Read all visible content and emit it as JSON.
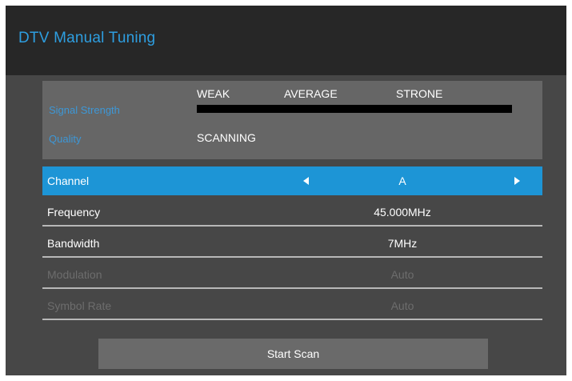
{
  "header": {
    "title": "DTV Manual Tuning"
  },
  "signal": {
    "strength_label": "Signal Strength",
    "quality_label": "Quality",
    "levels": [
      "WEAK",
      "AVERAGE",
      "STRONE"
    ],
    "strength_fraction": 0,
    "quality_value": "SCANNING"
  },
  "menu": {
    "rows": [
      {
        "label": "Channel",
        "value": "A",
        "selected": true,
        "disabled": false
      },
      {
        "label": "Frequency",
        "value": "45.000MHz",
        "selected": false,
        "disabled": false
      },
      {
        "label": "Bandwidth",
        "value": "7MHz",
        "selected": false,
        "disabled": false
      },
      {
        "label": "Modulation",
        "value": "Auto",
        "selected": false,
        "disabled": true
      },
      {
        "label": "Symbol Rate",
        "value": "Auto",
        "selected": false,
        "disabled": true
      }
    ]
  },
  "actions": {
    "start_scan_label": "Start Scan"
  },
  "colors": {
    "accent": "#1d95d6",
    "title": "#2e9ee0",
    "background": "#474747",
    "header": "#272727",
    "disabled_text": "#6d6d6d"
  }
}
